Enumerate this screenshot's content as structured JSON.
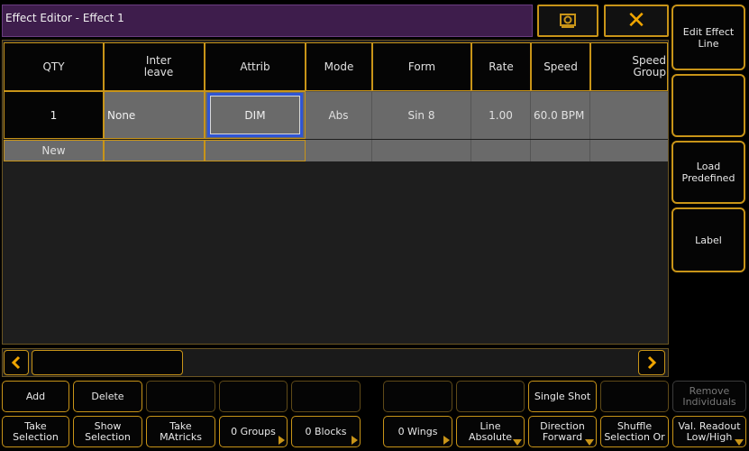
{
  "window": {
    "title": "Effect Editor - Effect 1",
    "close_symbol": "✕"
  },
  "right_panel": {
    "edit_effect_line": "Edit Effect Line",
    "load_predefined": "Load Predefined",
    "label": "Label",
    "remove_individuals": "Remove Individuals",
    "val_readout": "Val. Readout Low/High"
  },
  "table": {
    "headers": [
      "QTY",
      "Inter leave",
      "Attrib",
      "Mode",
      "Form",
      "Rate",
      "Speed",
      "Speed Group"
    ],
    "row1": {
      "qty": "1",
      "interleave": "None",
      "attrib": "DIM",
      "mode": "Abs",
      "form": "Sin 8",
      "rate": "1.00",
      "speed": "60.0 BPM"
    },
    "new_row_label": "New"
  },
  "bottom_row1": {
    "add": "Add",
    "delete": "Delete",
    "single_shot": "Single Shot"
  },
  "bottom_row2": {
    "take_selection": "Take Selection",
    "show_selection": "Show Selection",
    "take_matricks": "Take MAtricks",
    "groups": "0 Groups",
    "blocks": "0 Blocks",
    "wings": "0 Wings",
    "line_absolute": "Line Absolute",
    "direction_forward": "Direction Forward",
    "shuffle_selection": "Shuffle Selection Or"
  },
  "colors": {
    "accent": "#c89418",
    "title_bg": "#3e1d4c",
    "cell_gray": "#6a6a6a",
    "selected_border": "#2f55d4"
  }
}
